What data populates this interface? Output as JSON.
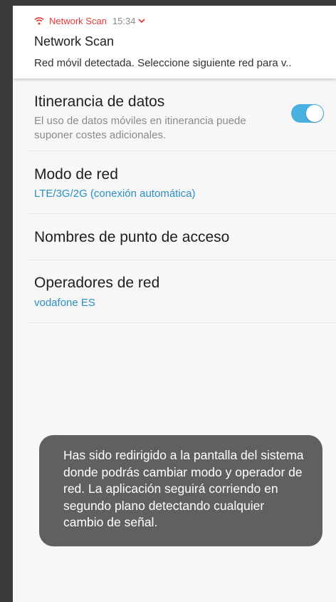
{
  "notification": {
    "app_name": "Network Scan",
    "time": "15:34",
    "title": "Network Scan",
    "text": "Red móvil detectada. Seleccione siguiente red para v.."
  },
  "settings": {
    "roaming": {
      "title": "Itinerancia de datos",
      "description": "El uso de datos móviles en itinerancia puede suponer costes adicionales.",
      "enabled": true
    },
    "network_mode": {
      "title": "Modo de red",
      "value": "LTE/3G/2G (conexión automática)"
    },
    "apn": {
      "title": "Nombres de punto de acceso"
    },
    "operators": {
      "title": "Operadores de red",
      "value": "vodafone ES"
    }
  },
  "toast": {
    "message": "Has sido redirigido a la pantalla del sistema donde podrás cambiar modo y operador de red. La aplicación seguirá corriendo en segundo plano detectando cualquier cambio de señal."
  },
  "colors": {
    "accent": "#2b8fc2",
    "toggle_on": "#49b1e0",
    "notification_app": "#e53935",
    "toast_bg": "#606060"
  }
}
